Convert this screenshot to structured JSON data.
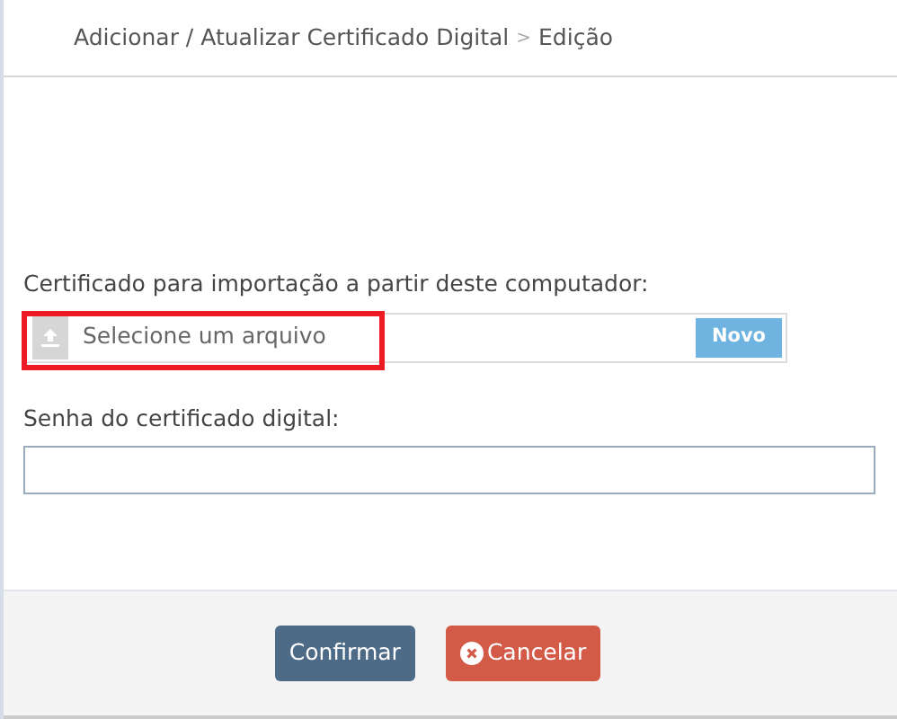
{
  "breadcrumb": {
    "parent": "Adicionar / Atualizar Certificado Digital",
    "separator": ">",
    "current": "Edição"
  },
  "certificate_field": {
    "label": "Certificado para importação a partir deste computador:",
    "placeholder": "Selecione um arquivo",
    "button": "Novo",
    "highlighted": true
  },
  "password_field": {
    "label": "Senha do certificado digital:"
  },
  "buttons": [
    {
      "kind": "primary",
      "label": "Confirmar"
    },
    {
      "kind": "danger",
      "label": "Cancelar"
    }
  ]
}
